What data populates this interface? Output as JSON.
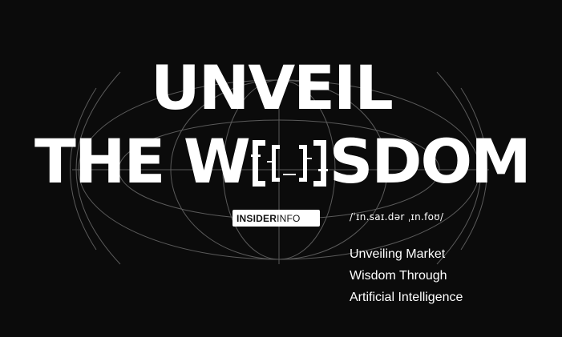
{
  "hero": {
    "line1": "UNVEIL",
    "line2_before": "THE W",
    "line2_after": "SDOM"
  },
  "brand": {
    "bold": "INSIDER",
    "light": "INFO"
  },
  "phonetic": "/ˈɪn.saɪ.dər ˌɪn.foʊ/",
  "tagline": {
    "lines": [
      "Unveiling Market",
      "Wisdom Through",
      "Artificial Intelligence"
    ]
  },
  "colors": {
    "background": "#0b0b0b",
    "text": "#ffffff",
    "lines": "#5a5a5a",
    "badge_bg": "#ffffff",
    "badge_text": "#111111"
  }
}
